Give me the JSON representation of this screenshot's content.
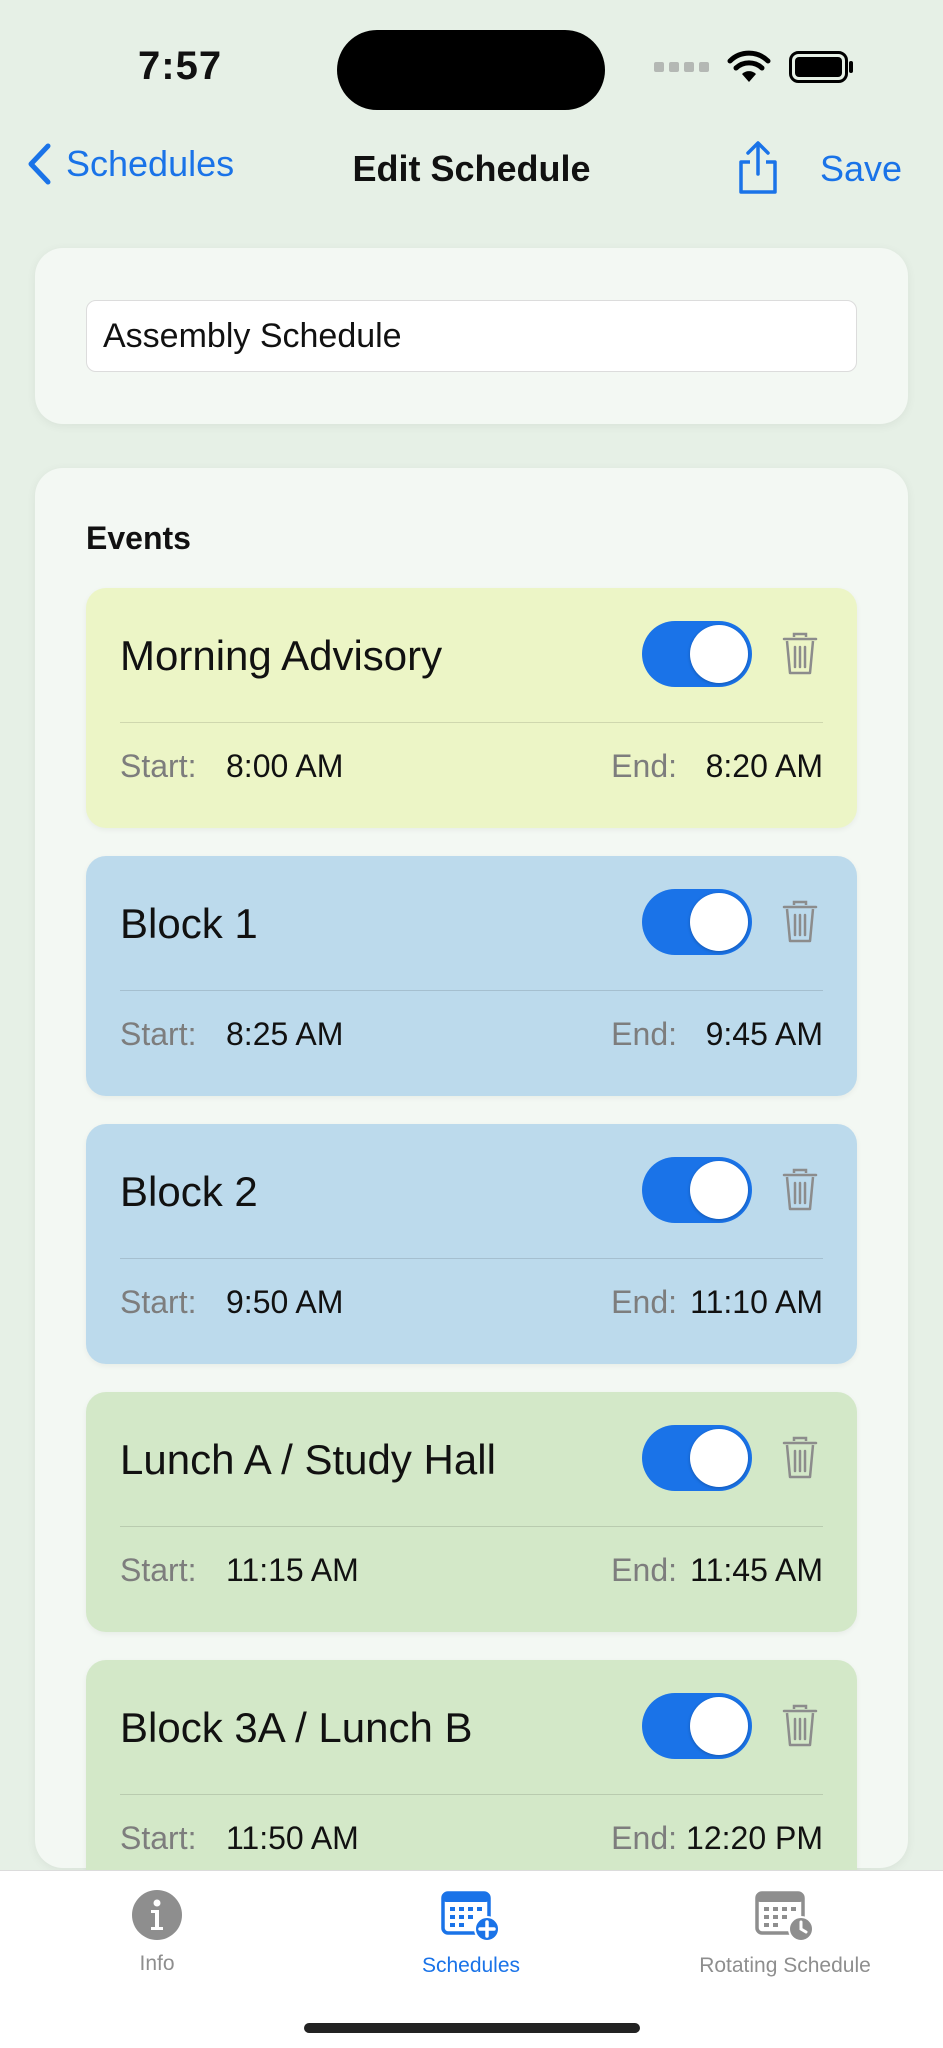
{
  "status_bar": {
    "time": "7:57"
  },
  "nav": {
    "back_label": "Schedules",
    "title": "Edit Schedule",
    "save_label": "Save"
  },
  "schedule_name": {
    "value": "Assembly Schedule"
  },
  "events_section": {
    "title": "Events",
    "start_label": "Start:",
    "end_label": "End:",
    "items": [
      {
        "name": "Morning Advisory",
        "start": "8:00 AM",
        "end": "8:20 AM",
        "enabled": true,
        "color": "#ecf5c6"
      },
      {
        "name": "Block 1",
        "start": "8:25 AM",
        "end": "9:45 AM",
        "enabled": true,
        "color": "#bcdaec"
      },
      {
        "name": "Block 2",
        "start": "9:50 AM",
        "end": "11:10 AM",
        "enabled": true,
        "color": "#bcdaec"
      },
      {
        "name": "Lunch A / Study Hall",
        "start": "11:15 AM",
        "end": "11:45 AM",
        "enabled": true,
        "color": "#d3e8c8"
      },
      {
        "name": "Block 3A / Lunch B",
        "start": "11:50 AM",
        "end": "12:20 PM",
        "enabled": true,
        "color": "#d3e8c8"
      }
    ]
  },
  "tabs": [
    {
      "label": "Info",
      "icon": "info-icon",
      "active": false
    },
    {
      "label": "Schedules",
      "icon": "calendar-add-icon",
      "active": true
    },
    {
      "label": "Rotating Schedule",
      "icon": "calendar-clock-icon",
      "active": false
    }
  ],
  "colors": {
    "accent": "#1a73e8",
    "background": "#e6f0e6",
    "inactive": "#8e8e8e"
  }
}
